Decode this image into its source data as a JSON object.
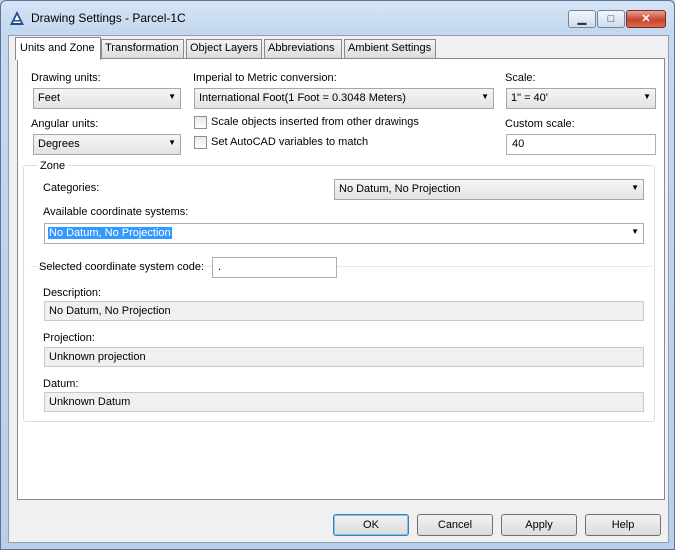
{
  "window": {
    "title": "Drawing Settings - Parcel-1C",
    "icon": "autocad-a-icon",
    "controls": {
      "minimize": "minimize-icon",
      "maximize": "maximize-icon",
      "close": "close-icon"
    }
  },
  "tabs": [
    {
      "label": "Units and Zone",
      "active": true
    },
    {
      "label": "Transformation",
      "active": false
    },
    {
      "label": "Object Layers",
      "active": false
    },
    {
      "label": "Abbreviations",
      "active": false
    },
    {
      "label": "Ambient Settings",
      "active": false
    }
  ],
  "units": {
    "drawing_units_label": "Drawing units:",
    "drawing_units_value": "Feet",
    "conversion_label": "Imperial to Metric conversion:",
    "conversion_value": "International Foot(1 Foot = 0.3048 Meters)",
    "scale_label": "Scale:",
    "scale_value": "1\" = 40'",
    "angular_label": "Angular units:",
    "angular_value": "Degrees",
    "scale_objects_label": "Scale objects inserted from other drawings",
    "scale_objects_checked": false,
    "set_variables_label": "Set AutoCAD variables to match",
    "set_variables_checked": false,
    "custom_scale_label": "Custom scale:",
    "custom_scale_value": "40"
  },
  "zone": {
    "group_label": "Zone",
    "categories_label": "Categories:",
    "categories_value": "No Datum, No Projection",
    "available_label": "Available coordinate systems:",
    "available_value": "No Datum, No Projection",
    "code_label": "Selected coordinate system code:",
    "code_value": ".",
    "description_label": "Description:",
    "description_value": "No Datum, No Projection",
    "projection_label": "Projection:",
    "projection_value": "Unknown projection",
    "datum_label": "Datum:",
    "datum_value": "Unknown Datum"
  },
  "buttons": {
    "ok": "OK",
    "cancel": "Cancel",
    "apply": "Apply",
    "help": "Help"
  },
  "glyphs": {
    "dropdown": "▼",
    "minimize": "▁",
    "maximize": "□",
    "close": "✕"
  }
}
